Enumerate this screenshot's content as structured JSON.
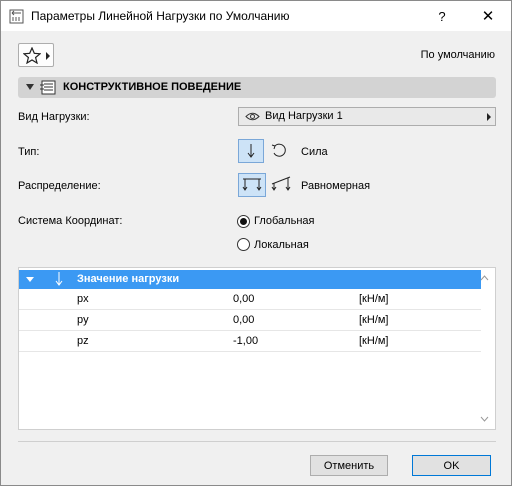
{
  "window": {
    "title": "Параметры Линейной Нагрузки по Умолчанию",
    "help_label": "?",
    "close_label": "✕"
  },
  "toolbar": {
    "favorites_icon": "star-icon",
    "default_label": "По умолчанию"
  },
  "section": {
    "title": "КОНСТРУКТИВНОЕ ПОВЕДЕНИЕ"
  },
  "fields": {
    "load_type_label": "Вид Нагрузки:",
    "load_type_value": "Вид Нагрузки 1",
    "type_label": "Тип:",
    "type_value": "Сила",
    "distribution_label": "Распределение:",
    "distribution_value": "Равномерная",
    "coord_label": "Система Координат:",
    "coord_options": [
      {
        "label": "Глобальная",
        "selected": true
      },
      {
        "label": "Локальная",
        "selected": false
      }
    ]
  },
  "table": {
    "header": "Значение нагрузки",
    "rows": [
      {
        "name": "px",
        "value": "0,00",
        "unit": "[кН/м]"
      },
      {
        "name": "py",
        "value": "0,00",
        "unit": "[кН/м]"
      },
      {
        "name": "pz",
        "value": "-1,00",
        "unit": "[кН/м]"
      }
    ]
  },
  "buttons": {
    "cancel": "Отменить",
    "ok": "OK"
  },
  "colors": {
    "accent": "#3b99f3",
    "section_bg": "#d3d3d3",
    "window_bg": "#f0f0f0"
  }
}
